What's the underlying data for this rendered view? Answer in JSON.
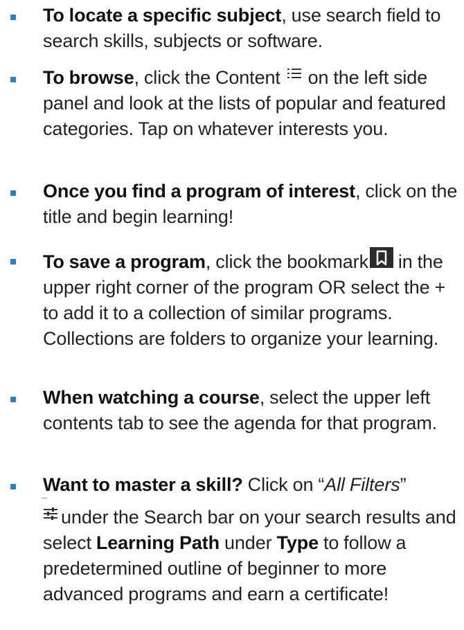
{
  "tips": [
    {
      "lead": "To locate a specific subject",
      "rest": ", use search field to search skills, subjects or software."
    },
    {
      "lead": "To browse",
      "part1": ", click the Content ",
      "icon": "list-icon",
      "part2": " on the left side panel and look at the lists of popular and featured categories. Tap on whatever interests you."
    },
    {
      "lead": "Once you find a program of interest",
      "rest": ", click on the title and begin learning!"
    },
    {
      "lead": "To save a program",
      "part1": ", click the bookmark",
      "icon": "bookmark-icon",
      "part2": " in the upper right corner of the program OR select the + to add it to a collection of similar programs. Collections are folders to organize your learning."
    },
    {
      "lead": "When watching a course",
      "rest": ", select the upper left contents tab to see the agenda for that program."
    },
    {
      "lead": "Want to master a skill?",
      "part1": " Click on “",
      "em": "All Filters",
      "part2": "”",
      "icon": "filters-icon",
      "part3": "under the Search bar on your search results and select ",
      "strong1": "Learning Path",
      "part4": " under ",
      "strong2": "Type",
      "part5": " to follow a predetermined outline of beginner to more advanced programs and earn a certificate!"
    }
  ],
  "colors": {
    "bullet": "#2f7fc1",
    "text": "#222222"
  }
}
